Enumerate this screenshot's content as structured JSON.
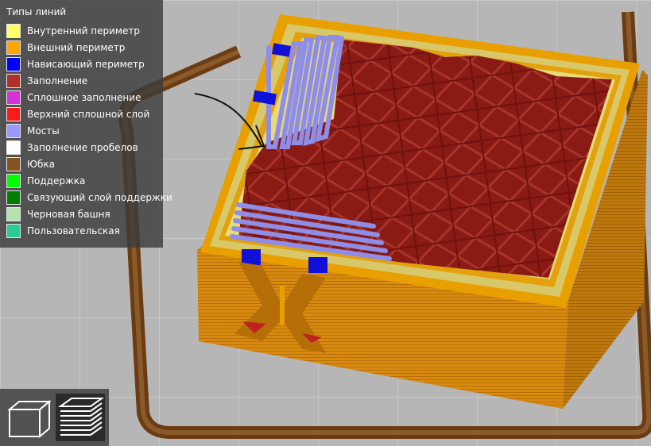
{
  "legend": {
    "title": "Типы линий",
    "items": [
      {
        "label": "Внутренний периметр",
        "color": "#ffff68"
      },
      {
        "label": "Внешний периметр",
        "color": "#ffa500"
      },
      {
        "label": "Нависающий периметр",
        "color": "#0000ff"
      },
      {
        "label": "Заполнение",
        "color": "#b03029"
      },
      {
        "label": "Сплошное заполнение",
        "color": "#d732d7"
      },
      {
        "label": "Верхний сплошной слой",
        "color": "#ff1a1a"
      },
      {
        "label": "Мосты",
        "color": "#9999ff"
      },
      {
        "label": "Заполнение пробелов",
        "color": "#ffffff"
      },
      {
        "label": "Юбка",
        "color": "#845321"
      },
      {
        "label": "Поддержка",
        "color": "#00ff00"
      },
      {
        "label": "Связующий слой поддержки",
        "color": "#008000"
      },
      {
        "label": "Черновая башня",
        "color": "#b3e3ab"
      },
      {
        "label": "Пользовательская",
        "color": "#28cc94"
      }
    ]
  },
  "toolbar": {
    "buttons": [
      {
        "icon": "cube-3d-view-icon",
        "active": false
      },
      {
        "icon": "layers-preview-icon",
        "active": true
      }
    ]
  }
}
